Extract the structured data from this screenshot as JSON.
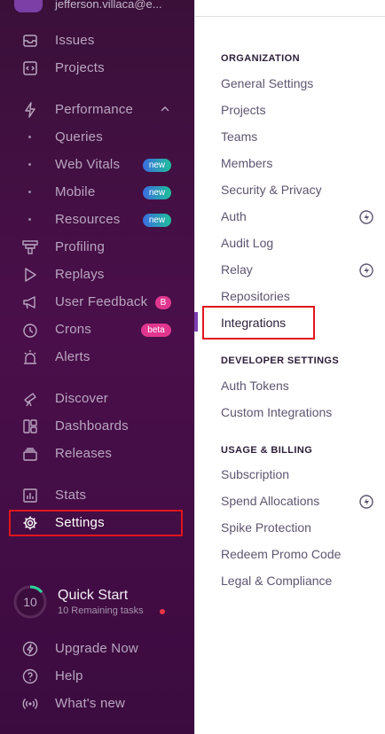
{
  "user": {
    "email": "jefferson.villaca@e..."
  },
  "sidebar": {
    "items": [
      {
        "label": "Issues",
        "icon": "inbox-icon"
      },
      {
        "label": "Projects",
        "icon": "code-window-icon"
      },
      {
        "label": "Performance",
        "icon": "lightning-icon"
      },
      {
        "label": "Queries",
        "icon": "dot"
      },
      {
        "label": "Web Vitals",
        "icon": "dot",
        "badge": "new"
      },
      {
        "label": "Mobile",
        "icon": "dot",
        "badge": "new"
      },
      {
        "label": "Resources",
        "icon": "dot",
        "badge": "new"
      },
      {
        "label": "Profiling",
        "icon": "profiling-icon"
      },
      {
        "label": "Replays",
        "icon": "play-icon"
      },
      {
        "label": "User Feedback",
        "icon": "megaphone-icon",
        "badge": "B"
      },
      {
        "label": "Crons",
        "icon": "timer-icon",
        "badge": "beta"
      },
      {
        "label": "Alerts",
        "icon": "siren-icon"
      },
      {
        "label": "Discover",
        "icon": "telescope-icon"
      },
      {
        "label": "Dashboards",
        "icon": "dashboard-icon"
      },
      {
        "label": "Releases",
        "icon": "stack-icon"
      },
      {
        "label": "Stats",
        "icon": "bar-chart-icon"
      },
      {
        "label": "Settings",
        "icon": "gear-icon"
      }
    ],
    "quick_start": {
      "title": "Quick Start",
      "count": "10",
      "subtitle": "10 Remaining tasks"
    },
    "footer": [
      {
        "label": "Upgrade Now",
        "icon": "lightning-circle-icon"
      },
      {
        "label": "Help",
        "icon": "question-icon"
      },
      {
        "label": "What's new",
        "icon": "broadcast-icon"
      }
    ]
  },
  "settings_nav": {
    "organization": {
      "title": "ORGANIZATION",
      "items": [
        "General Settings",
        "Projects",
        "Teams",
        "Members",
        "Security & Privacy",
        "Auth",
        "Audit Log",
        "Relay",
        "Repositories",
        "Integrations"
      ]
    },
    "developer": {
      "title": "DEVELOPER SETTINGS",
      "items": [
        "Auth Tokens",
        "Custom Integrations"
      ]
    },
    "billing": {
      "title": "USAGE & BILLING",
      "items": [
        "Subscription",
        "Spend Allocations",
        "Spike Protection",
        "Redeem Promo Code",
        "Legal & Compliance"
      ]
    }
  },
  "colors": {
    "sidebar_bg": "#3a1039",
    "accent": "#7c3fb3",
    "highlight": "#e0161c"
  }
}
